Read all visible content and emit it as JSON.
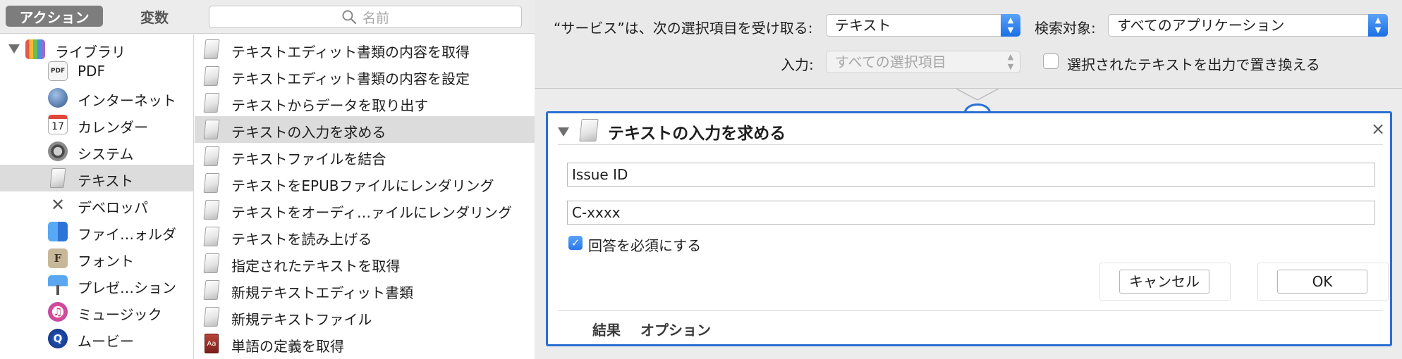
{
  "left_toolbar": {
    "actions_tab": "アクション",
    "variables_tab": "変数",
    "search_placeholder": "名前"
  },
  "library": {
    "root_label": "ライブラリ",
    "items": [
      {
        "label": "PDF",
        "icon": "pdf-icon"
      },
      {
        "label": "インターネット",
        "icon": "globe-icon"
      },
      {
        "label": "カレンダー",
        "icon": "calendar-icon",
        "icon_text": "17"
      },
      {
        "label": "システム",
        "icon": "system-icon"
      },
      {
        "label": "テキスト",
        "icon": "text-icon",
        "selected": true
      },
      {
        "label": "デベロッパ",
        "icon": "developer-icon"
      },
      {
        "label": "ファイ…ォルダ",
        "icon": "finder-icon"
      },
      {
        "label": "フォント",
        "icon": "font-icon",
        "icon_text": "F"
      },
      {
        "label": "プレゼ…ション",
        "icon": "keynote-icon"
      },
      {
        "label": "ミュージック",
        "icon": "music-icon",
        "icon_text": "♫"
      },
      {
        "label": "ムービー",
        "icon": "movie-icon",
        "icon_text": "Q"
      }
    ]
  },
  "actions": [
    {
      "label": "テキストエディット書類の内容を取得"
    },
    {
      "label": "テキストエディット書類の内容を設定"
    },
    {
      "label": "テキストからデータを取り出す"
    },
    {
      "label": "テキストの入力を求める",
      "selected": true
    },
    {
      "label": "テキストファイルを結合"
    },
    {
      "label": "テキストをEPUBファイルにレンダリング"
    },
    {
      "label": "テキストをオーディ…ァイルにレンダリング"
    },
    {
      "label": "テキストを読み上げる"
    },
    {
      "label": "指定されたテキストを取得"
    },
    {
      "label": "新規テキストエディット書類"
    },
    {
      "label": "新規テキストファイル"
    },
    {
      "label": "単語の定義を取得",
      "icon": "dictionary-icon"
    }
  ],
  "service_header": {
    "receives_label": "“サービス”は、次の選択項目を受け取る:",
    "receives_value": "テキスト",
    "search_target_label": "検索対象:",
    "search_target_value": "すべてのアプリケーション",
    "input_label": "入力:",
    "input_value": "すべての選択項目",
    "replace_checkbox_label": "選択されたテキストを出力で置き換える",
    "replace_checked": false
  },
  "action_card": {
    "title": "テキストの入力を求める",
    "close_glyph": "×",
    "prompt_field": "Issue ID",
    "default_field": "C-xxxx",
    "required_label": "回答を必須にする",
    "required_checked": true,
    "cancel_label": "キャンセル",
    "ok_label": "OK",
    "footer_tabs": [
      "結果",
      "オプション"
    ]
  },
  "colors": {
    "selection_blue": "#2a6fd3",
    "segment_active": "#7d7d7d",
    "row_selected": "#dcdcdc"
  }
}
